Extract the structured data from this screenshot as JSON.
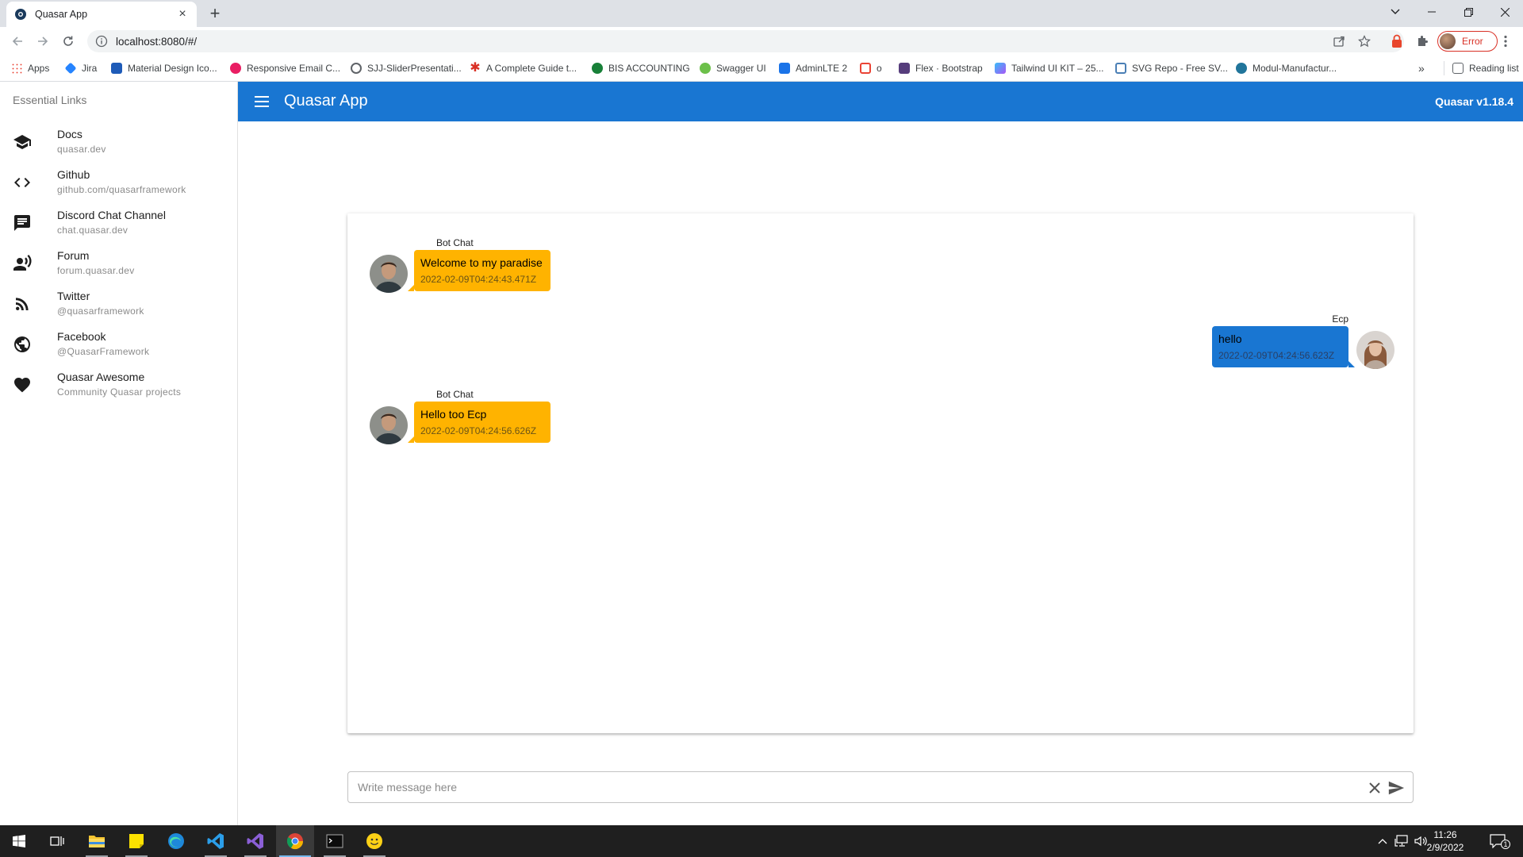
{
  "browser": {
    "tab_title": "Quasar App",
    "url": "localhost:8080/#/",
    "profile_label": "Error",
    "reading_list": "Reading list",
    "bookmarks": [
      {
        "label": "Apps",
        "color": "#4285f4"
      },
      {
        "label": "Jira",
        "color": "#2684ff"
      },
      {
        "label": "Material Design Ico...",
        "color": "#1e5bb8"
      },
      {
        "label": "Responsive Email C...",
        "color": "#e91e63"
      },
      {
        "label": "SJJ-SliderPresentati...",
        "color": "#5f6368"
      },
      {
        "label": "A Complete Guide t...",
        "color": "#d93025"
      },
      {
        "label": "BIS ACCOUNTING",
        "color": "#188038"
      },
      {
        "label": "Swagger UI",
        "color": "#6cc04a"
      },
      {
        "label": "AdminLTE 2",
        "color": "#1a73e8"
      },
      {
        "label": "o",
        "color": "#ea4335"
      },
      {
        "label": "Flex · Bootstrap",
        "color": "#563d7c"
      },
      {
        "label": "Tailwind UI KIT – 25...",
        "color": "#38bdf8"
      },
      {
        "label": "SVG Repo - Free SV...",
        "color": "#4a7fb5"
      },
      {
        "label": "Modul-Manufactur...",
        "color": "#21759b"
      }
    ]
  },
  "drawer": {
    "header": "Essential Links",
    "links": [
      {
        "title": "Docs",
        "caption": "quasar.dev",
        "icon": "school-icon"
      },
      {
        "title": "Github",
        "caption": "github.com/quasarframework",
        "icon": "code-icon"
      },
      {
        "title": "Discord Chat Channel",
        "caption": "chat.quasar.dev",
        "icon": "chat-icon"
      },
      {
        "title": "Forum",
        "caption": "forum.quasar.dev",
        "icon": "record-voice-icon"
      },
      {
        "title": "Twitter",
        "caption": "@quasarframework",
        "icon": "rss-feed-icon"
      },
      {
        "title": "Facebook",
        "caption": "@QuasarFramework",
        "icon": "public-icon"
      },
      {
        "title": "Quasar Awesome",
        "caption": "Community Quasar projects",
        "icon": "favorite-icon"
      }
    ]
  },
  "header": {
    "title": "Quasar App",
    "version": "Quasar v1.18.4",
    "color": "#1976d2"
  },
  "chat": {
    "messages": [
      {
        "name": "Bot Chat",
        "text": "Welcome to my paradise",
        "stamp": "2022-02-09T04:24:43.471Z",
        "sent": false
      },
      {
        "name": "Ecp",
        "text": "hello",
        "stamp": "2022-02-09T04:24:56.623Z",
        "sent": true
      },
      {
        "name": "Bot Chat",
        "text": "Hello too Ecp",
        "stamp": "2022-02-09T04:24:56.626Z",
        "sent": false
      }
    ],
    "bot_color": "#ffb300",
    "me_color": "#1976d2"
  },
  "input": {
    "placeholder": "Write message here",
    "value": ""
  },
  "taskbar": {
    "time": "11:26",
    "date": "2/9/2022",
    "notification_count": "1"
  }
}
